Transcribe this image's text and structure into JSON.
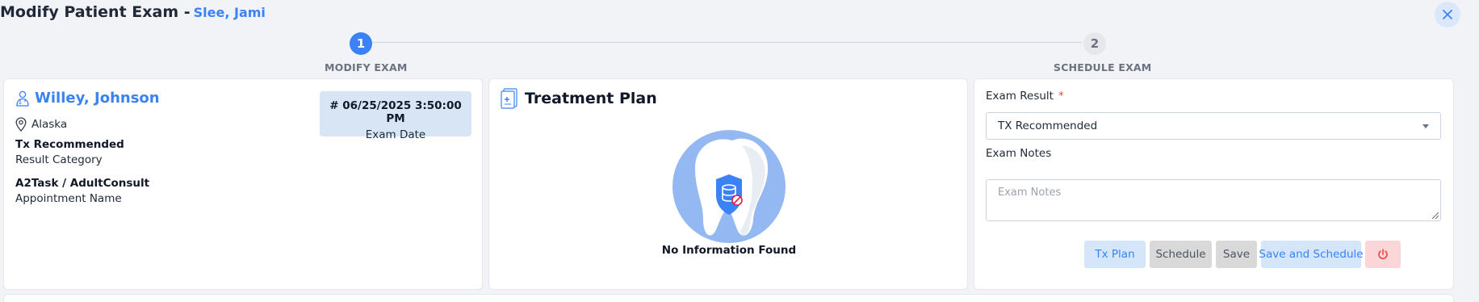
{
  "header": {
    "title": "Modify Patient Exam -",
    "patient_name": "Slee, Jami",
    "close_icon": "close-icon"
  },
  "stepper": {
    "steps": [
      {
        "number": "1",
        "label": "MODIFY EXAM",
        "active": true
      },
      {
        "number": "2",
        "label": "SCHEDULE EXAM",
        "active": false
      }
    ]
  },
  "exam_info": {
    "doctor_name": "Willey, Johnson",
    "location": "Alaska",
    "exam_date_value": "# 06/25/2025 3:50:00 PM",
    "exam_date_label": "Exam Date",
    "result_category_value": "Tx Recommended",
    "result_category_label": "Result Category",
    "appointment_value": "A2Task / AdultConsult",
    "appointment_label": "Appointment Name"
  },
  "treatment_plan": {
    "title": "Treatment Plan",
    "empty_text": "No Information Found"
  },
  "exam_form": {
    "exam_result_label": "Exam Result",
    "required_mark": "*",
    "exam_result_value": "TX Recommended",
    "exam_notes_label": "Exam Notes",
    "exam_notes_placeholder": "Exam Notes",
    "buttons": {
      "tx_plan": "Tx Plan",
      "schedule": "Schedule",
      "save": "Save",
      "save_and_schedule": "Save and Schedule",
      "power_icon": "power-icon"
    }
  },
  "colors": {
    "accent": "#3b82f6",
    "date_box": "#d7e5f5",
    "danger": "#ef4444"
  }
}
